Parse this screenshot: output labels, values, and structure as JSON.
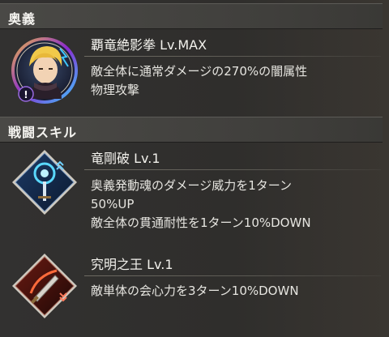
{
  "ougi": {
    "header": "奥義",
    "name": "覇竜絶影拳 Lv.MAX",
    "desc": [
      "敵全体に通常ダメージの270%の闇属性",
      "物理攻撃"
    ]
  },
  "battle_skills": {
    "header": "戦闘スキル",
    "items": [
      {
        "name": "竜剛破 Lv.1",
        "desc": [
          "奥義発動魂のダメージ威力を1ターン",
          "50%UP",
          "敵全体の貫通耐性を1ターン10%DOWN"
        ]
      },
      {
        "name": "究明之王 Lv.1",
        "desc": [
          "敵単体の会心力を3ターン10%DOWN"
        ]
      }
    ]
  },
  "colors": {
    "accent_blue": "#3ec8ff",
    "accent_red": "#e0412c",
    "accent_purple": "#7a3fd0"
  }
}
